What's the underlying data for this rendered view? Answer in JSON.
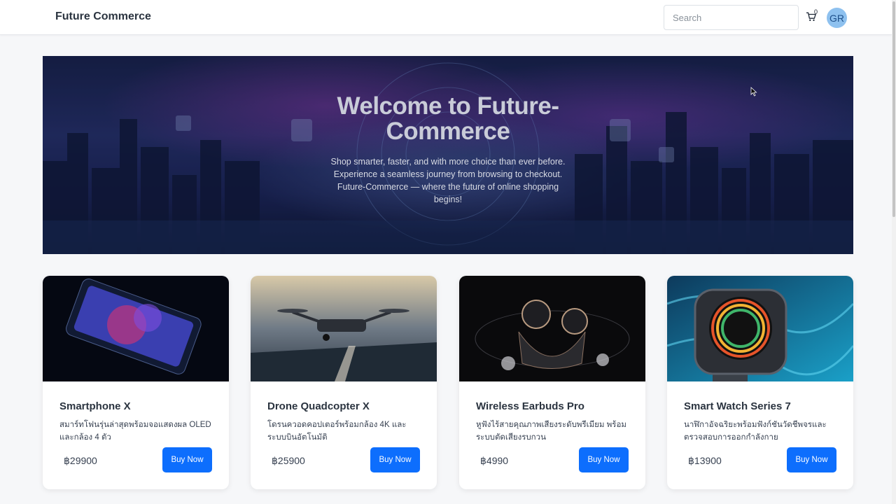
{
  "navbar": {
    "brand": "Future Commerce",
    "search_placeholder": "Search",
    "cart_count": "0",
    "avatar_initials": "GR"
  },
  "hero": {
    "title": "Welcome to Future-Commerce",
    "text": "Shop smarter, faster, and with more choice than ever before. Experience a seamless journey from browsing to checkout. Future-Commerce — where the future of online shopping begins!"
  },
  "products": [
    {
      "title": "Smartphone X",
      "description": "สมาร์ทโฟนรุ่นล่าสุดพร้อมจอแสดงผล OLED และกล้อง 4 ตัว",
      "price": "฿29900",
      "button": "Buy Now"
    },
    {
      "title": "Drone Quadcopter X",
      "description": "โดรนควอดคอปเตอร์พร้อมกล้อง 4K และระบบบินอัตโนมัติ",
      "price": "฿25900",
      "button": "Buy Now"
    },
    {
      "title": "Wireless Earbuds Pro",
      "description": "หูฟังไร้สายคุณภาพเสียงระดับพรีเมียม พร้อมระบบตัดเสียงรบกวน",
      "price": "฿4990",
      "button": "Buy Now"
    },
    {
      "title": "Smart Watch Series 7",
      "description": "นาฬิกาอัจฉริยะพร้อมฟังก์ชันวัดชีพจรและตรวจสอบการออกกำลังกาย",
      "price": "฿13900",
      "button": "Buy Now"
    }
  ],
  "colors": {
    "accent": "#0d6efd",
    "avatar_bg": "#8ec1ef",
    "page_bg": "#f6f7f9"
  },
  "icons": {
    "cart": "cart-icon",
    "cursor": "mouse-pointer-icon"
  }
}
